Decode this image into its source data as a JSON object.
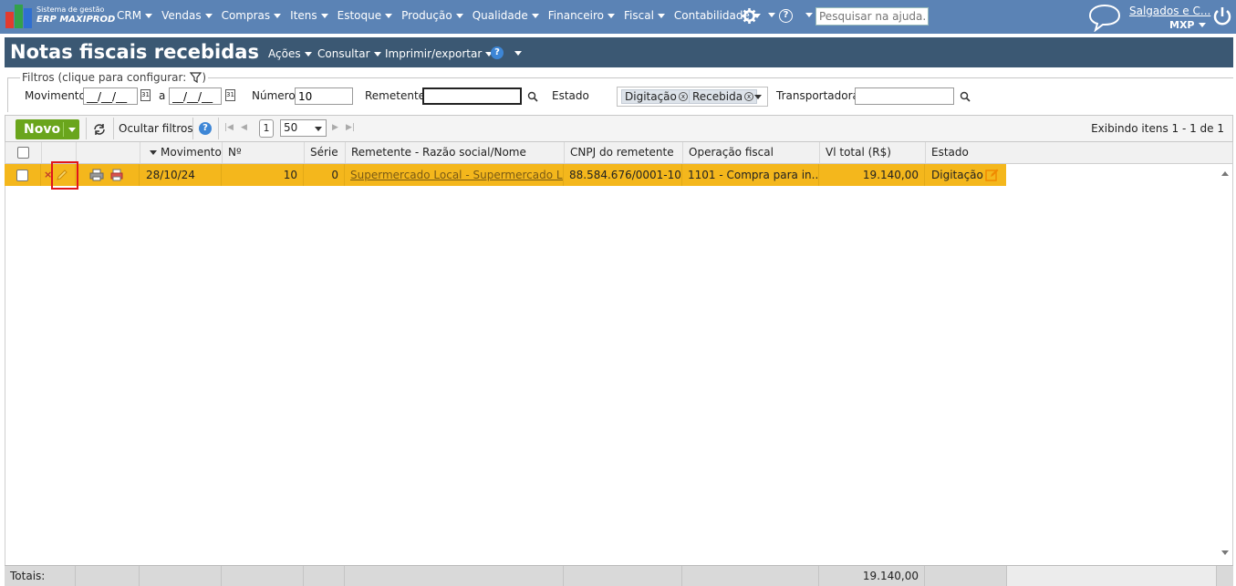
{
  "app": {
    "logo_line1": "Sistema de gestão",
    "logo_line2": "ERP MAXIPROD",
    "menu": [
      "CRM",
      "Vendas",
      "Compras",
      "Itens",
      "Estoque",
      "Produção",
      "Qualidade",
      "Financeiro",
      "Fiscal",
      "Contabilidade"
    ],
    "help_label": "?",
    "search_placeholder": "Pesquisar na ajuda...",
    "user_name": "Salgados e C...",
    "company": "MXP"
  },
  "page": {
    "title": "Notas fiscais recebidas",
    "actions_menu": [
      "Ações",
      "Consultar",
      "Imprimir/exportar"
    ],
    "help_label": "?"
  },
  "filters": {
    "legend": "Filtros (clique para configurar:",
    "legend_end": ")",
    "movimento_label": "Movimento",
    "date_from": "__/__/__",
    "date_sep": "a",
    "date_to": "__/__/__",
    "numero_label": "Número",
    "numero_value": "10",
    "remetente_label": "Remetente",
    "remetente_value": "",
    "estado_label": "Estado",
    "estado_chips": [
      "Digitação",
      "Recebida"
    ],
    "transportadora_label": "Transportadora",
    "transportadora_value": ""
  },
  "toolbar": {
    "new_label": "Novo",
    "hide_filters_label": "Ocultar filtros",
    "help_label": "?",
    "page": "1",
    "page_size": "50",
    "items_count": "Exibindo itens 1 - 1 de 1"
  },
  "grid": {
    "columns": [
      "Movimento",
      "Nº",
      "Série",
      "Remetente - Razão social/Nome",
      "CNPJ do remetente",
      "Operação fiscal",
      "Vl total (R$)",
      "Estado"
    ],
    "rows": [
      {
        "movimento": "28/10/24",
        "numero": "10",
        "serie": "0",
        "remetente": "Supermercado Local - Supermercado Lo...",
        "cnpj": "88.584.676/0001-10",
        "operacao": "1101 - Compra para in...",
        "valor": "19.140,00",
        "estado": "Digitação"
      }
    ],
    "totals_label": "Totais:",
    "totals_value": "19.140,00"
  },
  "colors": {
    "topbar": "#5b83b5",
    "titlebar": "#3b5873",
    "row_selected": "#f4b71c",
    "new_button": "#6aa51c",
    "highlight": "#e0151c"
  }
}
